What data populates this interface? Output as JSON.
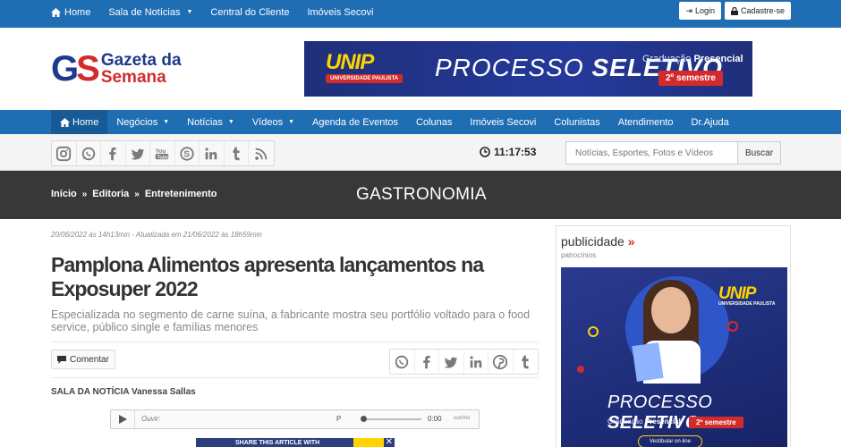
{
  "topbar": {
    "items": [
      {
        "label": "Home",
        "icon": "home-icon"
      },
      {
        "label": "Sala de Notícias",
        "dropdown": true
      },
      {
        "label": "Central do Cliente"
      },
      {
        "label": "Imóveis Secovi"
      }
    ],
    "login_label": "Login",
    "signup_label": "Cadastre-se"
  },
  "logo": {
    "mark_g": "G",
    "mark_s": "S",
    "line1": "Gazeta da",
    "line2": "Semana"
  },
  "banner": {
    "brand": "UNIP",
    "brand_sub": "UNIVERSIDADE PAULISTA",
    "headline_a": "PROCESSO",
    "headline_b": "SELETIVO",
    "grad_a": "Graduação",
    "grad_b": "Presencial",
    "semester": "2º semestre"
  },
  "mainnav": {
    "items": [
      {
        "label": "Home"
      },
      {
        "label": "Negócios"
      },
      {
        "label": "Notícias"
      },
      {
        "label": "Vídeos"
      },
      {
        "label": "Agenda de Eventos"
      },
      {
        "label": "Colunas"
      },
      {
        "label": "Imóveis Secovi"
      },
      {
        "label": "Colunistas"
      },
      {
        "label": "Atendimento"
      },
      {
        "label": "Dr.Ajuda"
      }
    ]
  },
  "toolbar": {
    "clock": "11:17:53",
    "search_placeholder": "Notícias, Esportes, Fotos e Vídeos",
    "search_button": "Buscar"
  },
  "breadcrumb": {
    "items": [
      "Início",
      "Editoria",
      "Entretenimento"
    ],
    "section": "GASTRONOMIA"
  },
  "article": {
    "meta": "20/06/2022 às 14h13min - Atualizada em 21/06/2022 às 18h59min",
    "headline": "Pamplona Alimentos apresenta lançamentos na Exposuper 2022",
    "subtitle": "Especializada no segmento de carne suína, a fabricante mostra seu portfólio voltado para o food service, público single e famílias menores",
    "comment_label": "Comentar",
    "author": "SALA DA NOTÍCIA Vanessa Sallas",
    "audio": {
      "label": "Ouvir",
      "p": "P",
      "time": "0:00",
      "outro": "outrino"
    },
    "share_bar_text": "SHARE THIS ARTICLE WITH"
  },
  "sidebar": {
    "title": "publicidade",
    "title_suffix": "»",
    "subtitle": "patrocínios",
    "ad": {
      "brand": "UNIP",
      "brand_sub": "UNIVERSIDADE PAULISTA",
      "headline_a": "PROCESSO",
      "headline_b": "SELETIVO",
      "grad_a": "Graduação",
      "grad_b": "Presencial",
      "semester": "2º semestre",
      "cta": "Vestibular on-line"
    }
  },
  "colors": {
    "brand_blue": "#1f6eb4",
    "dark_band": "#383838",
    "accent_red": "#d32b2b",
    "unip_yellow": "#ffd400"
  }
}
